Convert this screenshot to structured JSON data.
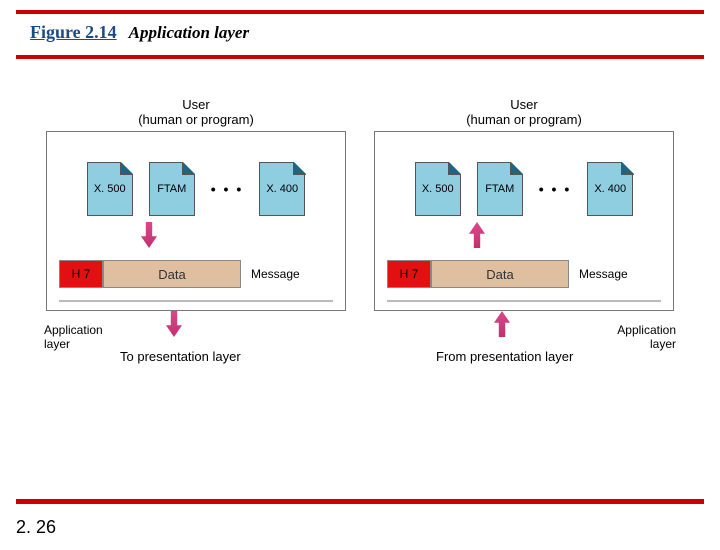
{
  "figure": {
    "number": "Figure 2.14",
    "title": "Application layer"
  },
  "left": {
    "user": "User\n(human or program)",
    "protocols": [
      "X. 500",
      "FTAM",
      "X. 400"
    ],
    "ellipsis": "• • •",
    "header_tag": "H 7",
    "data_label": "Data",
    "msg_label": "Message",
    "app_layer": "Application\nlayer",
    "dest": "To presentation layer"
  },
  "right": {
    "user": "User\n(human or program)",
    "protocols": [
      "X. 500",
      "FTAM",
      "X. 400"
    ],
    "ellipsis": "• • •",
    "header_tag": "H 7",
    "data_label": "Data",
    "msg_label": "Message",
    "app_layer": "Application\nlayer",
    "dest": "From presentation layer"
  },
  "page": "2. 26"
}
